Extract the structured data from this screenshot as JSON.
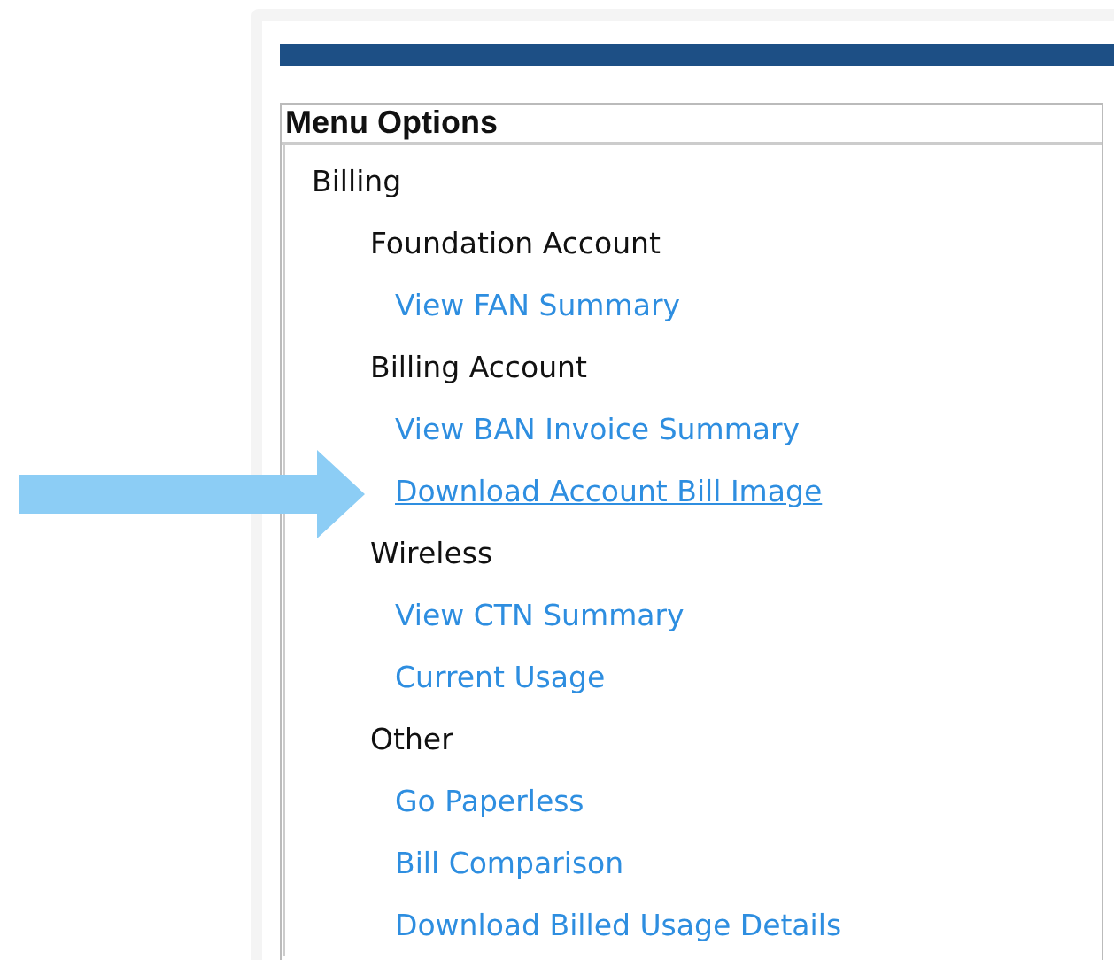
{
  "menu": {
    "title": "Menu Options",
    "items": [
      {
        "label": "Billing",
        "kind": "group",
        "children": [
          {
            "label": "Foundation Account",
            "kind": "category",
            "children": [
              {
                "label": "View FAN Summary",
                "kind": "link",
                "hovered": false
              }
            ]
          },
          {
            "label": "Billing Account",
            "kind": "category",
            "children": [
              {
                "label": "View BAN Invoice Summary",
                "kind": "link",
                "hovered": false
              },
              {
                "label": "Download Account Bill Image",
                "kind": "link",
                "hovered": true
              }
            ]
          },
          {
            "label": "Wireless",
            "kind": "category",
            "children": [
              {
                "label": "View CTN Summary",
                "kind": "link",
                "hovered": false
              },
              {
                "label": "Current Usage",
                "kind": "link",
                "hovered": false
              }
            ]
          },
          {
            "label": "Other",
            "kind": "category",
            "children": [
              {
                "label": "Go Paperless",
                "kind": "link",
                "hovered": false
              },
              {
                "label": "Bill Comparison",
                "kind": "link",
                "hovered": false
              },
              {
                "label": "Download Billed Usage Details",
                "kind": "link",
                "hovered": false
              }
            ]
          }
        ]
      }
    ]
  }
}
